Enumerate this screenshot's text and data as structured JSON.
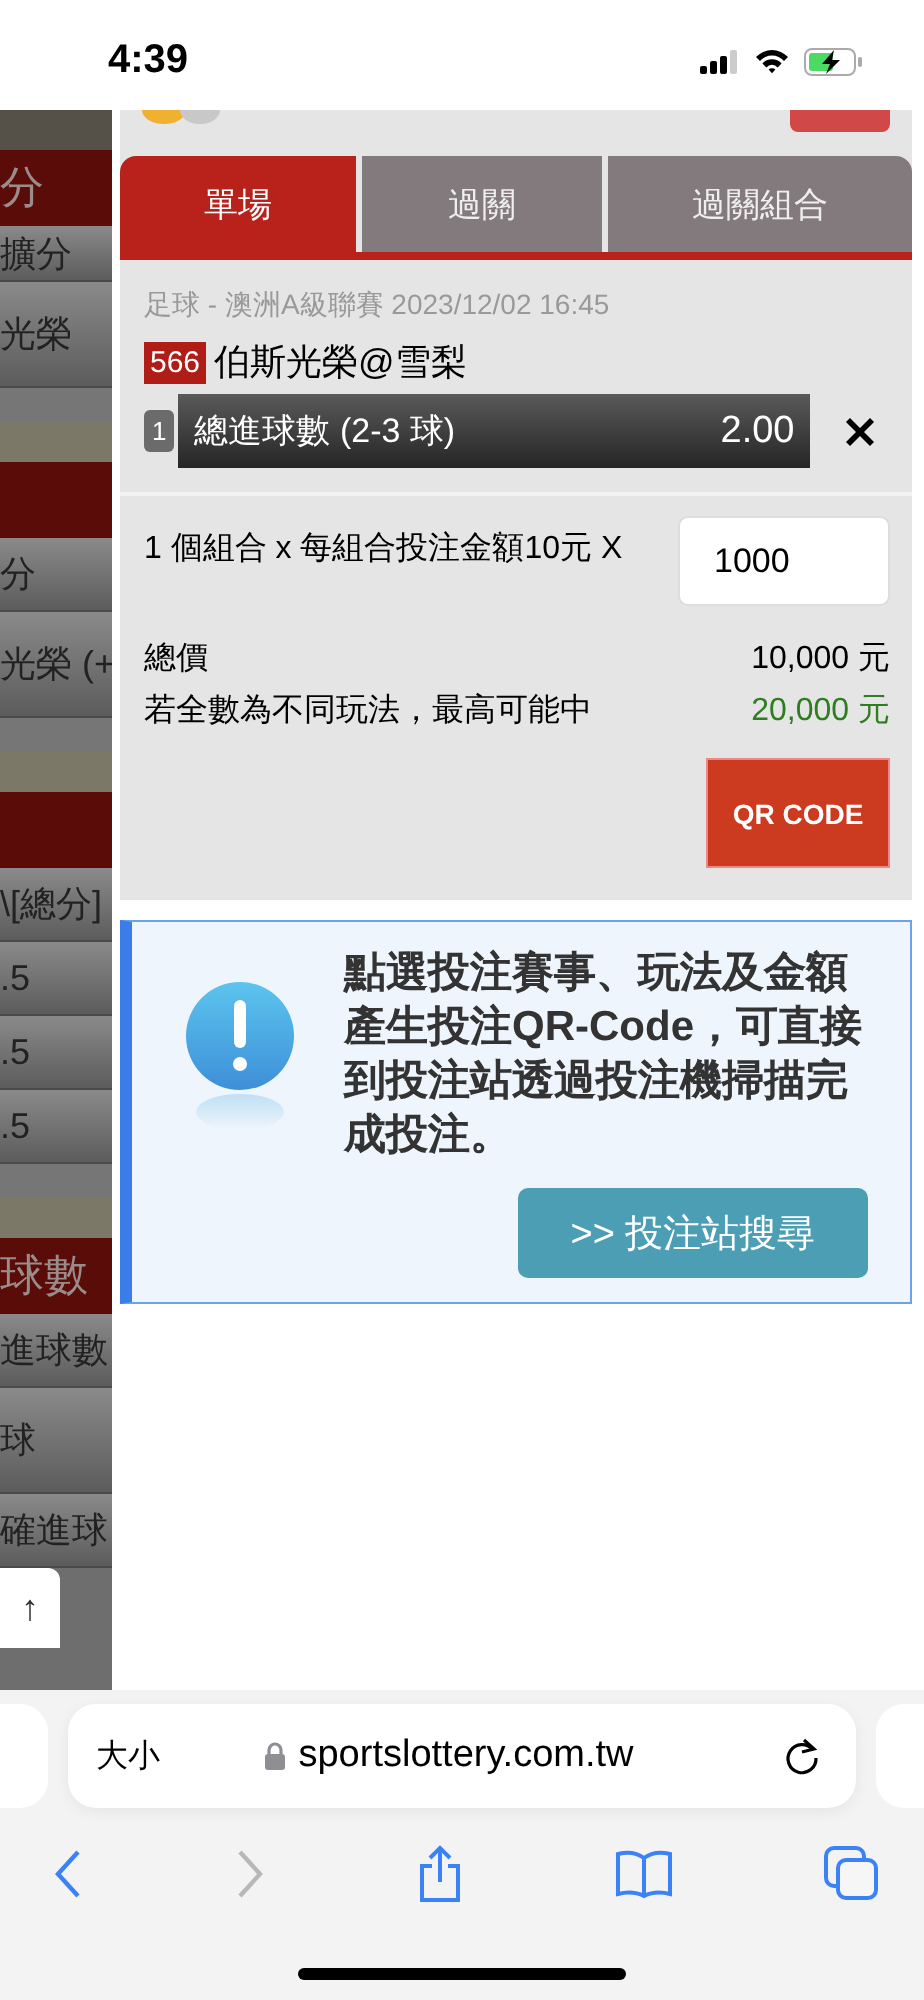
{
  "status_bar": {
    "time": "4:39"
  },
  "background_page": {
    "rows": [
      {
        "kind": "dark"
      },
      {
        "kind": "header",
        "text": "分"
      },
      {
        "kind": "short_row",
        "text": "擴分"
      },
      {
        "kind": "tall_row",
        "text": "光榮"
      },
      {
        "kind": "light"
      },
      {
        "kind": "beige"
      },
      {
        "kind": "header"
      },
      {
        "kind": "row",
        "text": "分"
      },
      {
        "kind": "tall_row",
        "text": "光榮 (+"
      },
      {
        "kind": "light"
      },
      {
        "kind": "beige"
      },
      {
        "kind": "header"
      },
      {
        "kind": "row",
        "text": "\\[總分]"
      },
      {
        "kind": "row",
        "text": ".5"
      },
      {
        "kind": "row",
        "text": ".5"
      },
      {
        "kind": "row",
        "text": ".5"
      },
      {
        "kind": "light"
      },
      {
        "kind": "beige"
      },
      {
        "kind": "header",
        "text": "球數"
      },
      {
        "kind": "row",
        "text": "進球數"
      },
      {
        "kind": "tall_row",
        "text": "球"
      },
      {
        "kind": "row",
        "text": "確進球"
      },
      {
        "kind": "top",
        "text": "↑"
      }
    ]
  },
  "bet_slip": {
    "tabs": [
      {
        "label": "單場",
        "selected": true
      },
      {
        "label": "過關",
        "selected": false
      },
      {
        "label": "過關組合",
        "selected": false
      }
    ],
    "match": {
      "league_line": "足球 - 澳洲A級聯賽 2023/12/02 16:45",
      "code": "566",
      "teams": "伯斯光榮@雪梨",
      "selection": {
        "index": "1",
        "name": "總進球數 (2-3 球)",
        "odds": "2.00"
      }
    },
    "stake": {
      "formula": "1 個組合 x 每組合投注金額10元 X",
      "amount": "1000"
    },
    "totals": [
      {
        "label": "總價",
        "value": "10,000 元",
        "kind": "plain"
      },
      {
        "label": "若全數為不同玩法，最高可能中",
        "value": "20,000 元",
        "kind": "win"
      }
    ],
    "qr_button": "QR CODE"
  },
  "notice": {
    "text": "點選投注賽事、玩法及金額產生投注QR-Code，可直接到投注站透過投注機掃描完成投注。",
    "button": ">> 投注站搜尋"
  },
  "browser": {
    "size_button": "大小",
    "url": "sportslottery.com.tw"
  }
}
